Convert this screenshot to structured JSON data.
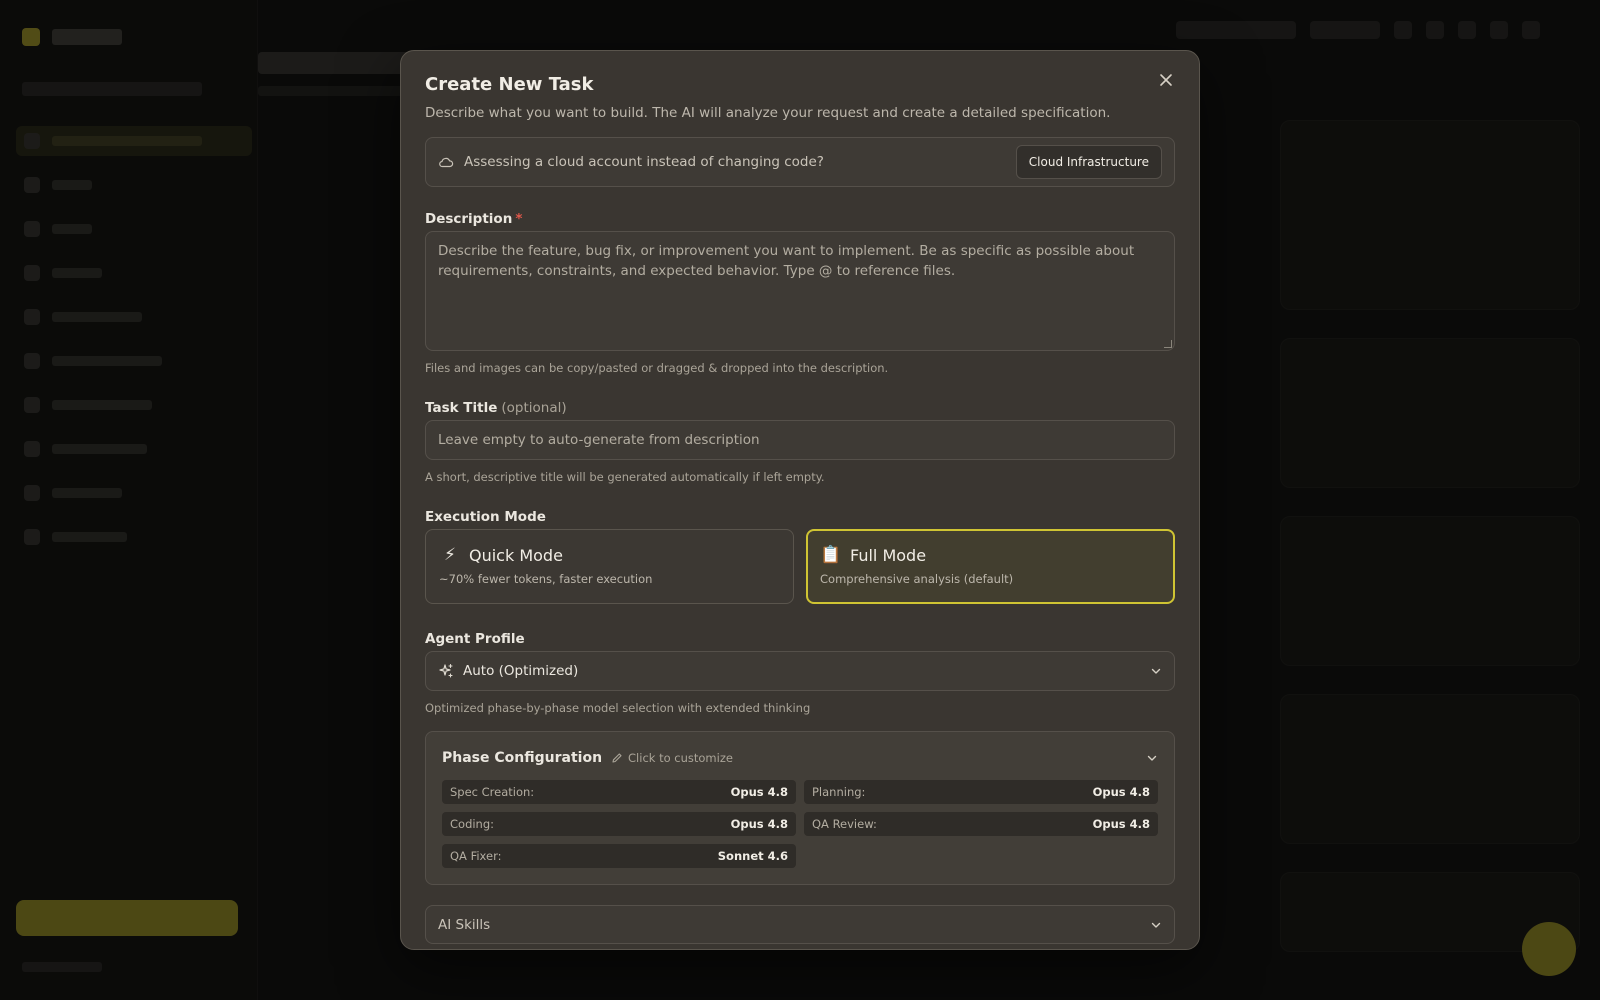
{
  "dialog": {
    "title": "Create New Task",
    "description": "Describe what you want to build. The AI will analyze your request and create a detailed specification.",
    "close_icon": "x-icon"
  },
  "cloud_banner": {
    "icon": "cloud-icon",
    "text": "Assessing a cloud account instead of changing code?",
    "button_label": "Cloud Infrastructure"
  },
  "description_field": {
    "label": "Description",
    "required_mark": "*",
    "placeholder": "Describe the feature, bug fix, or improvement you want to implement. Be as specific as possible about requirements, constraints, and expected behavior. Type @ to reference files.",
    "value": "",
    "hint": "Files and images can be copy/pasted or dragged & dropped into the description."
  },
  "title_field": {
    "label": "Task Title",
    "optional_label": "(optional)",
    "placeholder": "Leave empty to auto-generate from description",
    "value": "",
    "hint": "A short, descriptive title will be generated automatically if left empty."
  },
  "execution_mode": {
    "label": "Execution Mode",
    "options": [
      {
        "icon": "⚡",
        "name": "Quick Mode",
        "description": "~70% fewer tokens, faster execution",
        "selected": false
      },
      {
        "icon": "📋",
        "name": "Full Mode",
        "description": "Comprehensive analysis (default)",
        "selected": true
      }
    ],
    "accent_color": "#cfc433"
  },
  "agent_profile": {
    "label": "Agent Profile",
    "icon": "sparkles-icon",
    "selected": "Auto (Optimized)",
    "hint": "Optimized phase-by-phase model selection with extended thinking"
  },
  "phase_configuration": {
    "title": "Phase Configuration",
    "edit_label": "Click to customize",
    "phases": [
      {
        "name": "Spec Creation:",
        "model": "Opus 4.8"
      },
      {
        "name": "Planning:",
        "model": "Opus 4.8"
      },
      {
        "name": "Coding:",
        "model": "Opus 4.8"
      },
      {
        "name": "QA Review:",
        "model": "Opus 4.8"
      },
      {
        "name": "QA Fixer:",
        "model": "Sonnet 4.6"
      }
    ]
  },
  "ai_skills": {
    "label": "AI Skills"
  }
}
